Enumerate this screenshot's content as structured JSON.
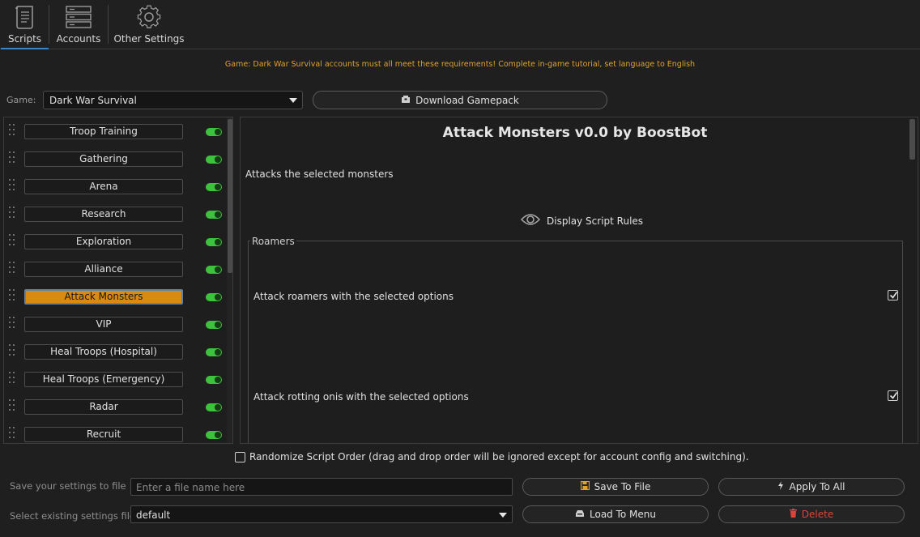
{
  "toolbar": {
    "tabs": [
      {
        "label": "Scripts",
        "icon": "scroll-icon",
        "active": true
      },
      {
        "label": "Accounts",
        "icon": "server-icon",
        "active": false
      },
      {
        "label": "Other Settings",
        "icon": "gear-icon",
        "active": false
      }
    ]
  },
  "notice": "Game: Dark War Survival accounts must all meet these requirements! Complete in-game tutorial, set language to English",
  "game": {
    "label": "Game:",
    "selected": "Dark War Survival",
    "download_label": "Download Gamepack"
  },
  "scripts": [
    {
      "label": "Troop Training",
      "enabled": true,
      "active": false
    },
    {
      "label": "Gathering",
      "enabled": true,
      "active": false
    },
    {
      "label": "Arena",
      "enabled": true,
      "active": false
    },
    {
      "label": "Research",
      "enabled": true,
      "active": false
    },
    {
      "label": "Exploration",
      "enabled": true,
      "active": false
    },
    {
      "label": "Alliance",
      "enabled": true,
      "active": false
    },
    {
      "label": "Attack Monsters",
      "enabled": true,
      "active": true
    },
    {
      "label": "VIP",
      "enabled": true,
      "active": false
    },
    {
      "label": "Heal Troops (Hospital)",
      "enabled": true,
      "active": false
    },
    {
      "label": "Heal Troops (Emergency)",
      "enabled": true,
      "active": false
    },
    {
      "label": "Radar",
      "enabled": true,
      "active": false
    },
    {
      "label": "Recruit",
      "enabled": true,
      "active": false
    }
  ],
  "detail": {
    "title": "Attack Monsters v0.0 by BoostBot",
    "description": "Attacks the selected monsters",
    "rules_label": "Display Script Rules",
    "group_label": "Roamers",
    "options": [
      {
        "label": "Attack roamers with the selected options",
        "checked": true
      },
      {
        "label": "Attack rotting onis with the selected options",
        "checked": true
      }
    ]
  },
  "randomize": {
    "label": "Randomize Script Order (drag and drop order will be ignored except for account config and switching).",
    "checked": false
  },
  "save": {
    "label": "Save your settings to file",
    "placeholder": "Enter a file name here",
    "save_btn": "Save To File",
    "apply_btn": "Apply To All"
  },
  "load": {
    "label": "Select existing settings file",
    "selected": "default",
    "load_btn": "Load To Menu",
    "delete_btn": "Delete"
  },
  "colors": {
    "accent": "#d98a12",
    "toggle_on": "#3cc23c",
    "notice": "#e0a22e",
    "danger": "#d9453b",
    "tab_underline": "#3b84c8"
  }
}
